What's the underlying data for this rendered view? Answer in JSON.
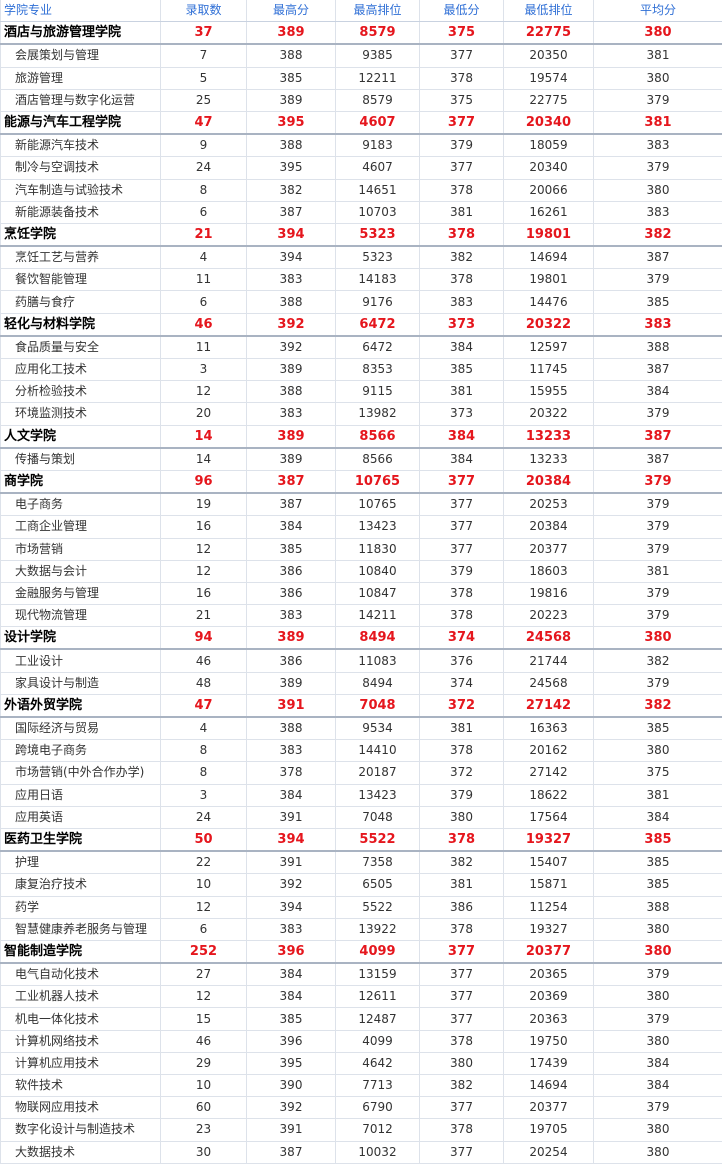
{
  "header": [
    "学院专业",
    "录取数",
    "最高分",
    "最高排位",
    "最低分",
    "最低排位",
    "平均分"
  ],
  "rows": [
    {
      "type": "college",
      "cells": [
        "酒店与旅游管理学院",
        "37",
        "389",
        "8579",
        "375",
        "22775",
        "380"
      ]
    },
    {
      "type": "major",
      "cells": [
        "会展策划与管理",
        "7",
        "388",
        "9385",
        "377",
        "20350",
        "381"
      ]
    },
    {
      "type": "major",
      "cells": [
        "旅游管理",
        "5",
        "385",
        "12211",
        "378",
        "19574",
        "380"
      ]
    },
    {
      "type": "major",
      "cells": [
        "酒店管理与数字化运营",
        "25",
        "389",
        "8579",
        "375",
        "22775",
        "379"
      ]
    },
    {
      "type": "college",
      "cells": [
        "能源与汽车工程学院",
        "47",
        "395",
        "4607",
        "377",
        "20340",
        "381"
      ]
    },
    {
      "type": "major",
      "cells": [
        "新能源汽车技术",
        "9",
        "388",
        "9183",
        "379",
        "18059",
        "383"
      ]
    },
    {
      "type": "major",
      "cells": [
        "制冷与空调技术",
        "24",
        "395",
        "4607",
        "377",
        "20340",
        "379"
      ]
    },
    {
      "type": "major",
      "cells": [
        "汽车制造与试验技术",
        "8",
        "382",
        "14651",
        "378",
        "20066",
        "380"
      ]
    },
    {
      "type": "major",
      "cells": [
        "新能源装备技术",
        "6",
        "387",
        "10703",
        "381",
        "16261",
        "383"
      ]
    },
    {
      "type": "college",
      "cells": [
        "烹饪学院",
        "21",
        "394",
        "5323",
        "378",
        "19801",
        "382"
      ]
    },
    {
      "type": "major",
      "cells": [
        "烹饪工艺与营养",
        "4",
        "394",
        "5323",
        "382",
        "14694",
        "387"
      ]
    },
    {
      "type": "major",
      "cells": [
        "餐饮智能管理",
        "11",
        "383",
        "14183",
        "378",
        "19801",
        "379"
      ]
    },
    {
      "type": "major",
      "cells": [
        "药膳与食疗",
        "6",
        "388",
        "9176",
        "383",
        "14476",
        "385"
      ]
    },
    {
      "type": "college",
      "cells": [
        "轻化与材料学院",
        "46",
        "392",
        "6472",
        "373",
        "20322",
        "383"
      ]
    },
    {
      "type": "major",
      "cells": [
        "食品质量与安全",
        "11",
        "392",
        "6472",
        "384",
        "12597",
        "388"
      ]
    },
    {
      "type": "major",
      "cells": [
        "应用化工技术",
        "3",
        "389",
        "8353",
        "385",
        "11745",
        "387"
      ]
    },
    {
      "type": "major",
      "cells": [
        "分析检验技术",
        "12",
        "388",
        "9115",
        "381",
        "15955",
        "384"
      ]
    },
    {
      "type": "major",
      "cells": [
        "环境监测技术",
        "20",
        "383",
        "13982",
        "373",
        "20322",
        "379"
      ]
    },
    {
      "type": "college",
      "cells": [
        "人文学院",
        "14",
        "389",
        "8566",
        "384",
        "13233",
        "387"
      ]
    },
    {
      "type": "major",
      "cells": [
        "传播与策划",
        "14",
        "389",
        "8566",
        "384",
        "13233",
        "387"
      ]
    },
    {
      "type": "college",
      "cells": [
        "商学院",
        "96",
        "387",
        "10765",
        "377",
        "20384",
        "379"
      ]
    },
    {
      "type": "major",
      "cells": [
        "电子商务",
        "19",
        "387",
        "10765",
        "377",
        "20253",
        "379"
      ]
    },
    {
      "type": "major",
      "cells": [
        "工商企业管理",
        "16",
        "384",
        "13423",
        "377",
        "20384",
        "379"
      ]
    },
    {
      "type": "major",
      "cells": [
        "市场营销",
        "12",
        "385",
        "11830",
        "377",
        "20377",
        "379"
      ]
    },
    {
      "type": "major",
      "cells": [
        "大数据与会计",
        "12",
        "386",
        "10840",
        "379",
        "18603",
        "381"
      ]
    },
    {
      "type": "major",
      "cells": [
        "金融服务与管理",
        "16",
        "386",
        "10847",
        "378",
        "19816",
        "379"
      ]
    },
    {
      "type": "major",
      "cells": [
        "现代物流管理",
        "21",
        "383",
        "14211",
        "378",
        "20223",
        "379"
      ]
    },
    {
      "type": "college",
      "cells": [
        "设计学院",
        "94",
        "389",
        "8494",
        "374",
        "24568",
        "380"
      ]
    },
    {
      "type": "major",
      "cells": [
        "工业设计",
        "46",
        "386",
        "11083",
        "376",
        "21744",
        "382"
      ]
    },
    {
      "type": "major",
      "cells": [
        "家具设计与制造",
        "48",
        "389",
        "8494",
        "374",
        "24568",
        "379"
      ]
    },
    {
      "type": "college",
      "cells": [
        "外语外贸学院",
        "47",
        "391",
        "7048",
        "372",
        "27142",
        "382"
      ]
    },
    {
      "type": "major",
      "cells": [
        "国际经济与贸易",
        "4",
        "388",
        "9534",
        "381",
        "16363",
        "385"
      ]
    },
    {
      "type": "major",
      "cells": [
        "跨境电子商务",
        "8",
        "383",
        "14410",
        "378",
        "20162",
        "380"
      ]
    },
    {
      "type": "major",
      "cells": [
        "市场营销(中外合作办学)",
        "8",
        "378",
        "20187",
        "372",
        "27142",
        "375"
      ]
    },
    {
      "type": "major",
      "cells": [
        "应用日语",
        "3",
        "384",
        "13423",
        "379",
        "18622",
        "381"
      ]
    },
    {
      "type": "major",
      "cells": [
        "应用英语",
        "24",
        "391",
        "7048",
        "380",
        "17564",
        "384"
      ]
    },
    {
      "type": "college",
      "cells": [
        "医药卫生学院",
        "50",
        "394",
        "5522",
        "378",
        "19327",
        "385"
      ]
    },
    {
      "type": "major",
      "cells": [
        "护理",
        "22",
        "391",
        "7358",
        "382",
        "15407",
        "385"
      ]
    },
    {
      "type": "major",
      "cells": [
        "康复治疗技术",
        "10",
        "392",
        "6505",
        "381",
        "15871",
        "385"
      ]
    },
    {
      "type": "major",
      "cells": [
        "药学",
        "12",
        "394",
        "5522",
        "386",
        "11254",
        "388"
      ]
    },
    {
      "type": "major",
      "cells": [
        "智慧健康养老服务与管理",
        "6",
        "383",
        "13922",
        "378",
        "19327",
        "380"
      ]
    },
    {
      "type": "college",
      "cells": [
        "智能制造学院",
        "252",
        "396",
        "4099",
        "377",
        "20377",
        "380"
      ]
    },
    {
      "type": "major",
      "cells": [
        "电气自动化技术",
        "27",
        "384",
        "13159",
        "377",
        "20365",
        "379"
      ]
    },
    {
      "type": "major",
      "cells": [
        "工业机器人技术",
        "12",
        "384",
        "12611",
        "377",
        "20369",
        "380"
      ]
    },
    {
      "type": "major",
      "cells": [
        "机电一体化技术",
        "15",
        "385",
        "12487",
        "377",
        "20363",
        "379"
      ]
    },
    {
      "type": "major",
      "cells": [
        "计算机网络技术",
        "46",
        "396",
        "4099",
        "378",
        "19750",
        "380"
      ]
    },
    {
      "type": "major",
      "cells": [
        "计算机应用技术",
        "29",
        "395",
        "4642",
        "380",
        "17439",
        "384"
      ]
    },
    {
      "type": "major",
      "cells": [
        "软件技术",
        "10",
        "390",
        "7713",
        "382",
        "14694",
        "384"
      ]
    },
    {
      "type": "major",
      "cells": [
        "物联网应用技术",
        "60",
        "392",
        "6790",
        "377",
        "20377",
        "379"
      ]
    },
    {
      "type": "major",
      "cells": [
        "数字化设计与制造技术",
        "23",
        "391",
        "7012",
        "378",
        "19705",
        "380"
      ]
    },
    {
      "type": "major",
      "cells": [
        "大数据技术",
        "30",
        "387",
        "10032",
        "377",
        "20254",
        "380"
      ]
    }
  ]
}
